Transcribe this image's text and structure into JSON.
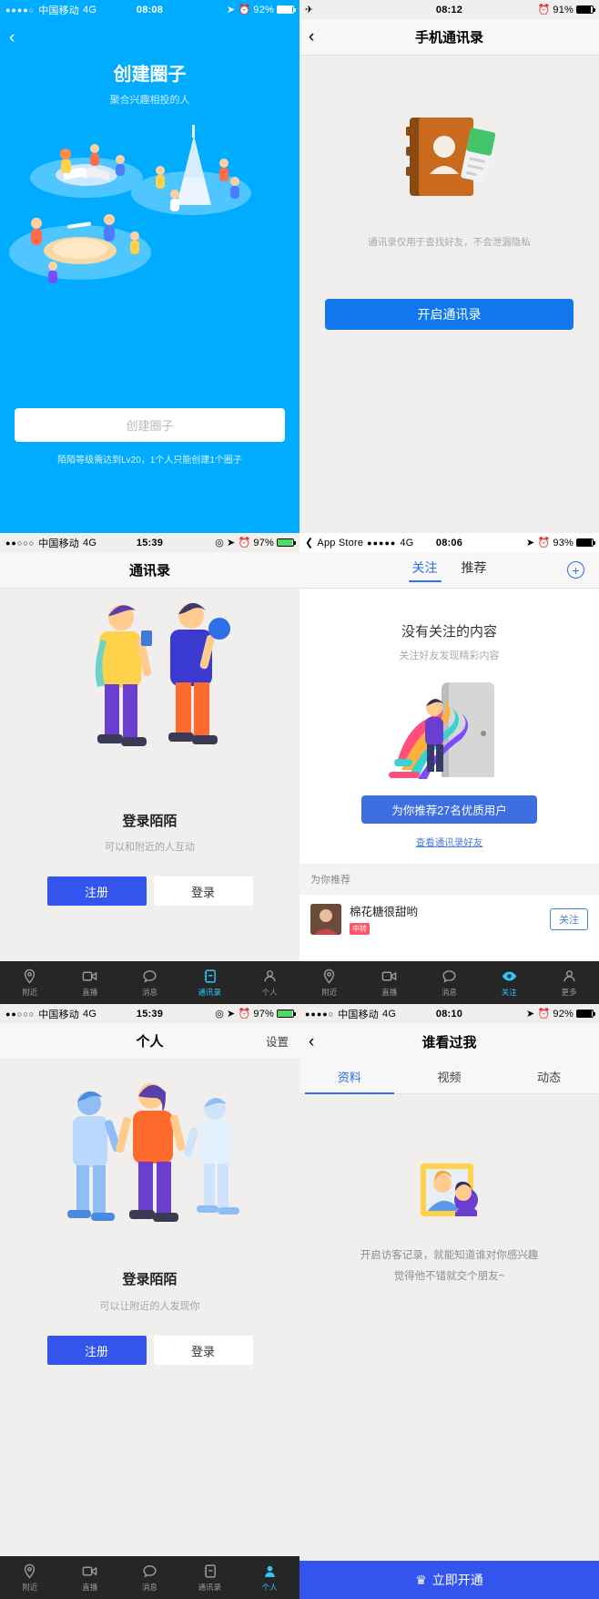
{
  "panel1": {
    "status": {
      "carrier": "中国移动",
      "network": "4G",
      "time": "08:08",
      "battery": "92%",
      "dots": "●●●●○"
    },
    "back_icon": "‹",
    "title": "创建圈子",
    "subtitle": "聚合兴趣相投的人",
    "cta_placeholder": "创建圈子",
    "note": "陌陌等级需达到Lv20，1个人只能创建1个圈子",
    "bg_color": "#00acff"
  },
  "panel2": {
    "status": {
      "airplane": "✈",
      "time": "08:12",
      "battery": "91%"
    },
    "back_icon": "‹",
    "title": "手机通讯录",
    "tip": "通讯录仅用于查找好友，不会泄漏隐私",
    "button_label": "开启通讯录",
    "button_color": "#1177ee"
  },
  "panel3": {
    "status": {
      "carrier": "中国移动",
      "network": "4G",
      "time": "15:39",
      "battery": "97%",
      "dots": "●●○○○"
    },
    "title": "通讯录",
    "heading": "登录陌陌",
    "subheading": "可以和附近的人互动",
    "register_label": "注册",
    "login_label": "登录",
    "tabs": [
      {
        "label": "附近",
        "icon": "location-pin-icon",
        "active": false
      },
      {
        "label": "直播",
        "icon": "video-camera-icon",
        "active": false
      },
      {
        "label": "消息",
        "icon": "chat-bubble-icon",
        "active": false
      },
      {
        "label": "通讯录",
        "icon": "contacts-book-icon",
        "active": true
      },
      {
        "label": "个人",
        "icon": "person-icon",
        "active": false
      }
    ]
  },
  "panel4": {
    "status": {
      "app": "App Store",
      "dots": "●●●●●",
      "network": "4G",
      "time": "08:06",
      "battery": "93%"
    },
    "tabs": [
      {
        "label": "关注",
        "active": true
      },
      {
        "label": "推荐",
        "active": false
      }
    ],
    "add_icon": "+",
    "empty_title": "没有关注的内容",
    "empty_subtitle": "关注好友发现精彩内容",
    "recommend_button": "为你推荐27名优质用户",
    "contacts_link": "查看通讯录好友",
    "section_header": "为你推荐",
    "user": {
      "name": "棉花糖很甜哟",
      "badge": "中转",
      "follow_label": "关注"
    },
    "bottom_tabs": [
      {
        "label": "附近",
        "icon": "location-pin-icon",
        "active": false
      },
      {
        "label": "直播",
        "icon": "video-camera-icon",
        "active": false
      },
      {
        "label": "消息",
        "icon": "chat-bubble-icon",
        "active": false
      },
      {
        "label": "关注",
        "icon": "eye-icon",
        "active": true
      },
      {
        "label": "更多",
        "icon": "person-icon",
        "active": false
      }
    ]
  },
  "panel5": {
    "status": {
      "carrier": "中国移动",
      "network": "4G",
      "time": "15:39",
      "battery": "97%",
      "dots": "●●○○○"
    },
    "title": "个人",
    "settings_label": "设置",
    "heading": "登录陌陌",
    "subheading": "可以让附近的人发现你",
    "register_label": "注册",
    "login_label": "登录",
    "tabs": [
      {
        "label": "附近",
        "icon": "location-pin-icon",
        "active": false
      },
      {
        "label": "直播",
        "icon": "video-camera-icon",
        "active": false
      },
      {
        "label": "消息",
        "icon": "chat-bubble-icon",
        "active": false
      },
      {
        "label": "通讯录",
        "icon": "contacts-book-icon",
        "active": false
      },
      {
        "label": "个人",
        "icon": "person-icon",
        "active": true
      }
    ]
  },
  "panel6": {
    "status": {
      "carrier": "中国移动",
      "network": "4G",
      "time": "08:10",
      "battery": "92%",
      "dots": "●●●●○"
    },
    "back_icon": "‹",
    "title": "谁看过我",
    "tabs": [
      {
        "label": "资料",
        "active": true
      },
      {
        "label": "视频",
        "active": false
      },
      {
        "label": "动态",
        "active": false
      }
    ],
    "line1": "开启访客记录，就能知道谁对你感兴趣",
    "line2": "觉得他不错就交个朋友~",
    "crown_icon": "♛",
    "open_label": "立即开通",
    "open_color": "#3355ee"
  }
}
